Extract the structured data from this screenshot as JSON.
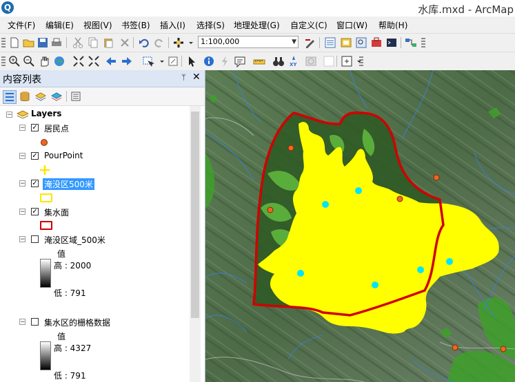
{
  "titlebar": {
    "title": "水库.mxd - ArcMap",
    "app_icon": "Q"
  },
  "menu": [
    "文件(F)",
    "编辑(E)",
    "视图(V)",
    "书签(B)",
    "插入(I)",
    "选择(S)",
    "地理处理(G)",
    "自定义(C)",
    "窗口(W)",
    "帮助(H)"
  ],
  "toolbar": {
    "scale": "1:100,000"
  },
  "toc": {
    "title": "内容列表",
    "pin_icon": "pin-icon",
    "close_icon": "close-icon",
    "root": "Layers",
    "layers": [
      {
        "name": "居民点",
        "checked": true,
        "symbol": "orange-dot"
      },
      {
        "name": "PourPoint",
        "checked": true,
        "symbol": "yellow-cross"
      },
      {
        "name": "淹没区500米",
        "checked": true,
        "selected": true,
        "symbol": "yellow-rect"
      },
      {
        "name": "集水面",
        "checked": true,
        "symbol": "red-rect"
      },
      {
        "name": "淹没区域_500米",
        "checked": false,
        "value_label": "值",
        "high": "高 : 2000",
        "low": "低 : 791"
      },
      {
        "name": "集水区的栅格数据",
        "checked": false,
        "value_label": "值",
        "high": "高 : 4327",
        "low": "低 : 791"
      }
    ]
  },
  "colors": {
    "accent": "#3399ff",
    "toc_header": "#dce6f4",
    "flood": "#ffff00",
    "catchment": "#d00000",
    "settlement": "#f26522",
    "pourpoint": "#00e5ff"
  }
}
